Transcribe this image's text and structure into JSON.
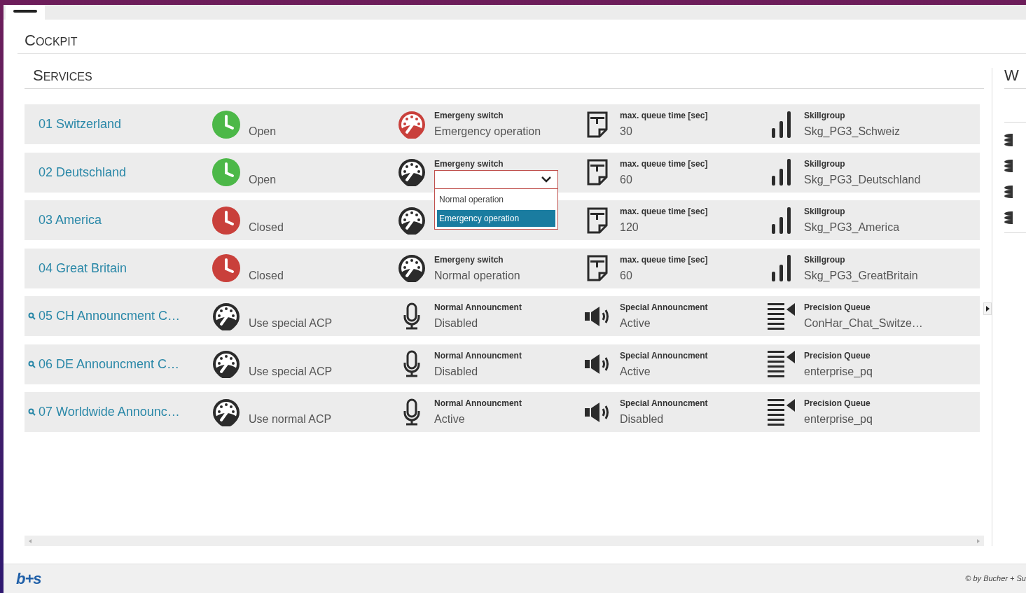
{
  "page_title": "COCKPIT",
  "services": {
    "title": "SERVICES",
    "rows": [
      {
        "name": "01 Switzerland",
        "search": false,
        "cells": [
          {
            "kind": "clock",
            "open": true,
            "value": "Open"
          },
          {
            "kind": "gauge",
            "alert": true,
            "label": "Emergeny switch",
            "value": "Emergency operation"
          },
          {
            "kind": "txt",
            "label": "max. queue time [sec]",
            "value": "30"
          },
          {
            "kind": "bars",
            "label": "Skillgroup",
            "value": "Skg_PG3_Schweiz"
          }
        ]
      },
      {
        "name": "02 Deutschland",
        "search": false,
        "cells": [
          {
            "kind": "clock",
            "open": true,
            "value": "Open"
          },
          {
            "kind": "gauge",
            "alert": false,
            "label": "Emergeny switch",
            "dropdown": {
              "expanded": true,
              "options": [
                {
                  "label": "Normal operation",
                  "selected": false
                },
                {
                  "label": "Emergency operation",
                  "selected": true
                }
              ]
            }
          },
          {
            "kind": "txt",
            "label": "max. queue time [sec]",
            "value": "60"
          },
          {
            "kind": "bars",
            "label": "Skillgroup",
            "value": "Skg_PG3_Deutschland"
          }
        ]
      },
      {
        "name": "03 America",
        "search": false,
        "cells": [
          {
            "kind": "clock",
            "open": false,
            "value": "Closed"
          },
          {
            "kind": "gauge",
            "alert": false
          },
          {
            "kind": "txt",
            "label": "max. queue time [sec]",
            "value": "120"
          },
          {
            "kind": "bars",
            "label": "Skillgroup",
            "value": "Skg_PG3_America"
          }
        ]
      },
      {
        "name": "04 Great Britain",
        "search": false,
        "cells": [
          {
            "kind": "clock",
            "open": false,
            "value": "Closed"
          },
          {
            "kind": "gauge",
            "alert": false,
            "label": "Emergeny switch",
            "value": "Normal operation"
          },
          {
            "kind": "txt",
            "label": "max. queue time [sec]",
            "value": "60"
          },
          {
            "kind": "bars",
            "label": "Skillgroup",
            "value": "Skg_PG3_GreatBritain"
          }
        ]
      },
      {
        "name": "05 CH Announcment C…",
        "search": true,
        "cells": [
          {
            "kind": "gauge",
            "alert": false,
            "value": "Use special ACP"
          },
          {
            "kind": "mic",
            "label": "Normal Announcment",
            "value": "Disabled"
          },
          {
            "kind": "speaker",
            "label": "Special Announcment",
            "value": "Active"
          },
          {
            "kind": "queue",
            "label": "Precision Queue",
            "value": "ConHar_Chat_Switze…"
          }
        ]
      },
      {
        "name": "06 DE Announcment C…",
        "search": true,
        "cells": [
          {
            "kind": "gauge",
            "alert": false,
            "value": "Use special ACP"
          },
          {
            "kind": "mic",
            "label": "Normal Announcment",
            "value": "Disabled"
          },
          {
            "kind": "speaker",
            "label": "Special Announcment",
            "value": "Active"
          },
          {
            "kind": "queue",
            "label": "Precision Queue",
            "value": "enterprise_pq"
          }
        ]
      },
      {
        "name": "07 Worldwide Announc…",
        "search": true,
        "cells": [
          {
            "kind": "gauge",
            "alert": false,
            "value": "Use normal ACP"
          },
          {
            "kind": "mic",
            "label": "Normal Announcment",
            "value": "Active"
          },
          {
            "kind": "speaker",
            "label": "Special Announcment",
            "value": "Disabled"
          },
          {
            "kind": "queue",
            "label": "Precision Queue",
            "value": "enterprise_pq"
          }
        ]
      }
    ]
  },
  "side_panel": {
    "title": "W"
  },
  "footer": {
    "logo": "b+s",
    "copyright": "© by Bucher + Su"
  }
}
